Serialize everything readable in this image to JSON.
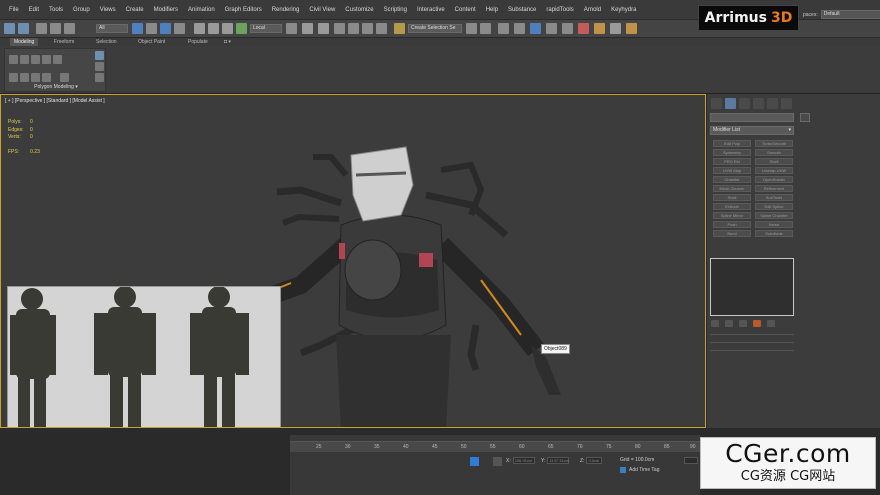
{
  "menubar": {
    "items": [
      "File",
      "Edit",
      "Tools",
      "Group",
      "Views",
      "Create",
      "Modifiers",
      "Animation",
      "Graph Editors",
      "Rendering",
      "Civil View",
      "Customize",
      "Scripting",
      "Interactive",
      "Content",
      "Help",
      "Substance",
      "rapidTools",
      "Arnold",
      "Keyhydra"
    ],
    "brand_main": "Arrimus",
    "brand_accent": "3D",
    "workspace_label": "paces:",
    "workspace_value": "Default"
  },
  "toolbar": {
    "filter_value": "All",
    "coord_system": "Local",
    "selection_set_placeholder": "Create Selection Se"
  },
  "ribbon": {
    "tabs": [
      "Modeling",
      "Freeform",
      "Selection",
      "Object Paint",
      "Populate"
    ],
    "active_tab": "Modeling",
    "panel_label": "Polygon Modeling ▾"
  },
  "viewport": {
    "label": "[ + ] [Perspective ] [Standard ] [Model Assist ]",
    "stats": [
      {
        "key": "Polys:",
        "value": "0"
      },
      {
        "key": "Edges:",
        "value": "0"
      },
      {
        "key": "Verts:",
        "value": "0"
      }
    ],
    "fps_label": "FPS:",
    "fps_value": "0.23",
    "tooltip": "Object089"
  },
  "command_panel": {
    "modifier_list": "Modifier List",
    "modifier_buttons": [
      "Edit Poly",
      "TurboSmooth",
      "Symmetry",
      "Smooth",
      "PRO Rel",
      "Shell",
      "UVW Map",
      "Unwrap UVW",
      "Chamfer",
      "OpenSubdiv",
      "Mesh Cleaner",
      "Refinement",
      "Shell",
      "SubTools",
      "Extrude",
      "Edit Spline",
      "Spline Mirror",
      "Spline Chamfer",
      "Push",
      "Noise",
      "Bend",
      "Subdivide"
    ]
  },
  "timeline": {
    "ticks": [
      "25",
      "30",
      "35",
      "40",
      "45",
      "50",
      "55",
      "60",
      "65",
      "70",
      "75",
      "80",
      "85",
      "90"
    ],
    "x_label": "X:",
    "x_value": "106.91cm",
    "y_label": "Y:",
    "y_value": "1137.31cm",
    "z_label": "Z:",
    "z_value": "0.0cm",
    "grid": "Grid = 100.0cm",
    "add_time_tag": "Add Time Tag"
  },
  "watermark": {
    "big": "CGer.com",
    "small": "CG资源  CG网站"
  }
}
